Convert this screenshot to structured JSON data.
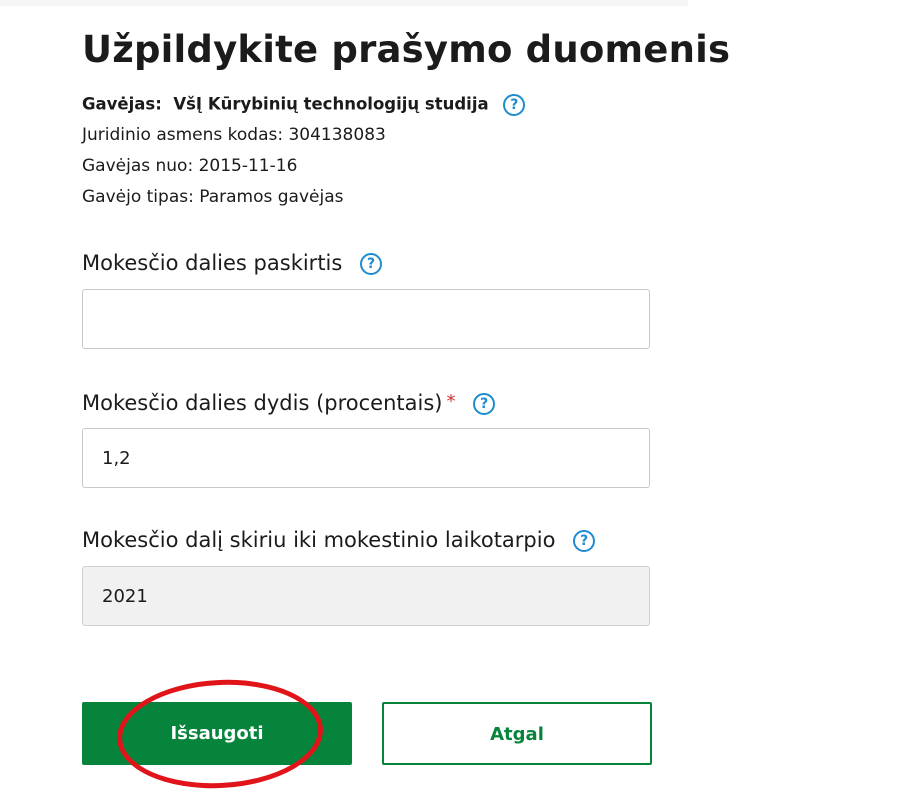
{
  "page": {
    "title": "Užpildykite prašymo duomenis"
  },
  "recipient": {
    "label": "Gavėjas:",
    "name": "VšĮ Kūrybinių technologijų studija",
    "code_line": "Juridinio asmens kodas: 304138083",
    "since_line": "Gavėjas nuo: 2015-11-16",
    "type_line": "Gavėjo tipas: Paramos gavėjas"
  },
  "help_icon_glyph": "?",
  "fields": {
    "purpose": {
      "label": "Mokesčio dalies paskirtis",
      "value": ""
    },
    "percent": {
      "label": "Mokesčio dalies dydis (procentais)",
      "required_mark": "*",
      "value": "1,2"
    },
    "period": {
      "label": "Mokesčio dalį skiriu iki mokestinio laikotarpio",
      "value": "2021"
    }
  },
  "buttons": {
    "save": "Išsaugoti",
    "back": "Atgal"
  },
  "colors": {
    "primary_green": "#07843c",
    "help_blue": "#1e8ccf",
    "required_red": "#d32f2f",
    "annotation_red": "#e1141a"
  }
}
